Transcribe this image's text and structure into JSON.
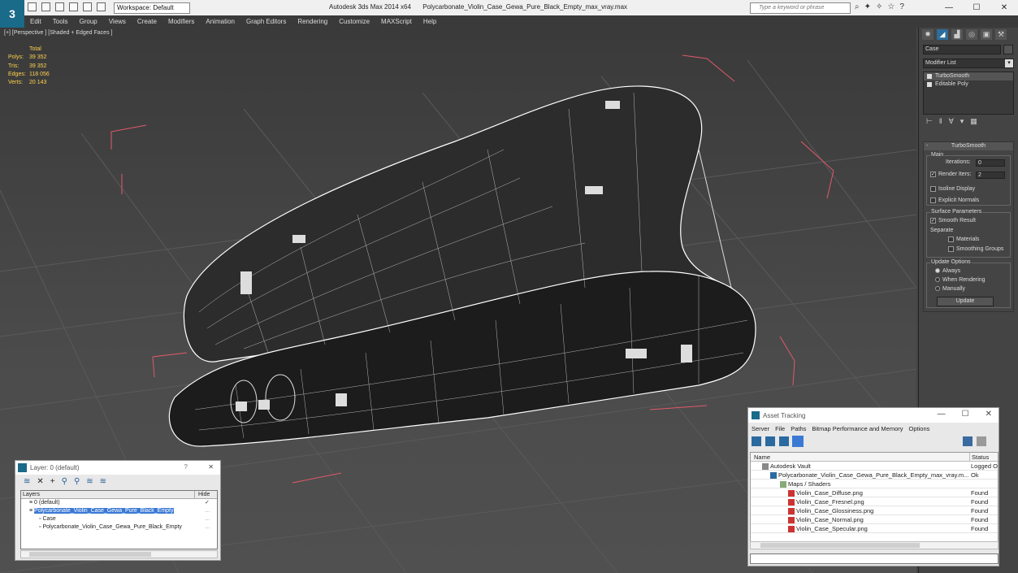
{
  "window": {
    "app_title": "Autodesk 3ds Max 2014 x64",
    "file_title": "Polycarbonate_Violin_Case_Gewa_Pure_Black_Empty_max_vray.max",
    "workspace": "Workspace: Default",
    "search_placeholder": "Type a keyword or phrase",
    "minimize": "—",
    "maximize": "☐",
    "close": "✕"
  },
  "menu": [
    "Edit",
    "Tools",
    "Group",
    "Views",
    "Create",
    "Modifiers",
    "Animation",
    "Graph Editors",
    "Rendering",
    "Customize",
    "MAXScript",
    "Help"
  ],
  "viewport": {
    "label": "[+] [Perspective ] [Shaded + Edged Faces ]",
    "stats_header": "Total",
    "stats": [
      {
        "k": "Polys:",
        "v": "39 352"
      },
      {
        "k": "Tris:",
        "v": "39 352"
      },
      {
        "k": "Edges:",
        "v": "118 056"
      },
      {
        "k": "Verts:",
        "v": "20 143"
      }
    ]
  },
  "command_panel": {
    "object_name": "Case",
    "modifier_list": "Modifier List",
    "stack": [
      "TurboSmooth",
      "Editable Poly"
    ],
    "rollout_title": "TurboSmooth",
    "main_group": "Main",
    "iterations_label": "Iterations:",
    "iterations_value": "0",
    "render_iters_label": "Render Iters:",
    "render_iters_value": "2",
    "isoline_display": "Isoline Display",
    "explicit_normals": "Explicit Normals",
    "surface_group": "Surface Parameters",
    "smooth_result": "Smooth Result",
    "separate": "Separate",
    "materials": "Materials",
    "smoothing_groups": "Smoothing Groups",
    "update_group": "Update Options",
    "always": "Always",
    "when_rendering": "When Rendering",
    "manually": "Manually",
    "update_button": "Update"
  },
  "layer_window": {
    "title": "Layer: 0 (default)",
    "help": "?",
    "close": "✕",
    "col_layers": "Layers",
    "col_hide": "Hide",
    "rows": [
      {
        "label": "0 (default)",
        "indent": 1
      },
      {
        "label": "Polycarbonate_Violin_Case_Gewa_Pure_Black_Empty",
        "indent": 1
      },
      {
        "label": "Case",
        "indent": 2
      },
      {
        "label": "Polycarbonate_Violin_Case_Gewa_Pure_Black_Empty",
        "indent": 2
      }
    ]
  },
  "asset_window": {
    "title": "Asset Tracking",
    "menu": [
      "Server",
      "File",
      "Paths",
      "Bitmap Performance and Memory",
      "Options"
    ],
    "col_name": "Name",
    "col_status": "Status",
    "rows": [
      {
        "name": "Autodesk Vault",
        "status": "Logged O",
        "icon": "vault"
      },
      {
        "name": "Polycarbonate_Violin_Case_Gewa_Pure_Black_Empty_max_vray.m...",
        "status": "Ok",
        "icon": "max"
      },
      {
        "name": "Maps / Shaders",
        "status": "",
        "icon": "folder"
      },
      {
        "name": "Violin_Case_Diffuse.png",
        "status": "Found",
        "icon": "file"
      },
      {
        "name": "Violin_Case_Fresnel.png",
        "status": "Found",
        "icon": "file"
      },
      {
        "name": "Violin_Case_Glossiness.png",
        "status": "Found",
        "icon": "file"
      },
      {
        "name": "Violin_Case_Normal.png",
        "status": "Found",
        "icon": "file"
      },
      {
        "name": "Violin_Case_Specular.png",
        "status": "Found",
        "icon": "file"
      }
    ]
  }
}
